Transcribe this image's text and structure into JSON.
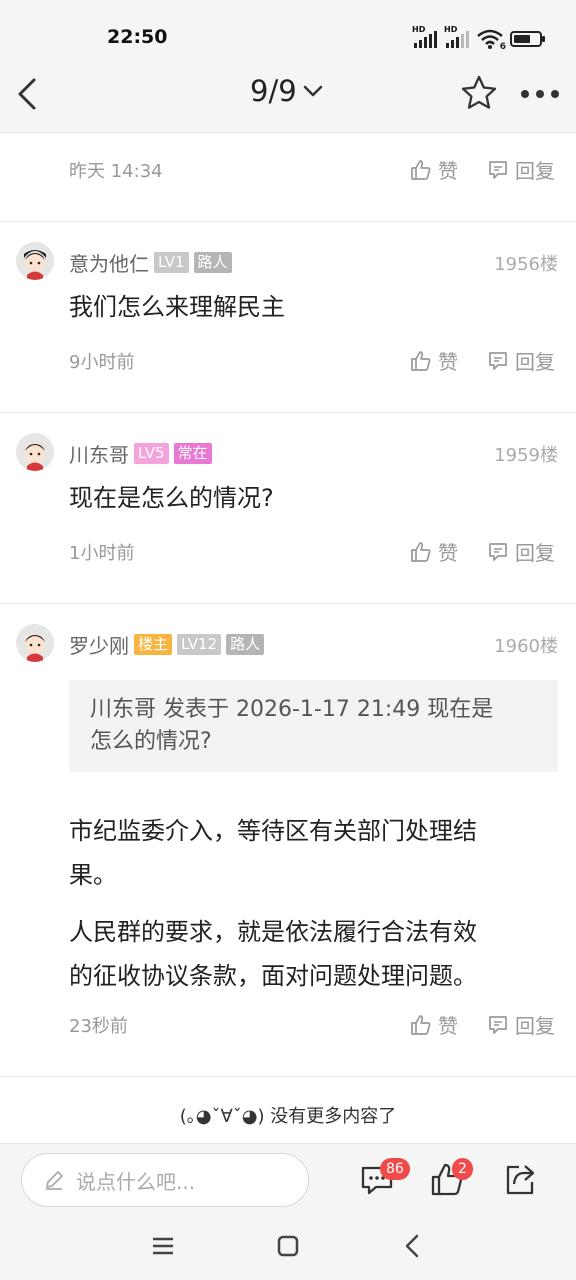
{
  "status": {
    "time": "22:50",
    "network_labels": [
      "HD",
      "HD"
    ],
    "wifi_badge": "6"
  },
  "topbar": {
    "page_indicator": "9/9"
  },
  "first_post": {
    "time": "昨天 14:34",
    "like_label": "赞",
    "reply_label": "回复"
  },
  "posts": [
    {
      "username": "意为他仁",
      "badges": [
        "LV1",
        "路人"
      ],
      "floor": "1956楼",
      "text": "我们怎么来理解民主",
      "time": "9小时前",
      "like_label": "赞",
      "reply_label": "回复"
    },
    {
      "username": "川东哥",
      "badges": [
        "LV5",
        "常在"
      ],
      "floor": "1959楼",
      "text": "现在是怎么的情况?",
      "time": "1小时前",
      "like_label": "赞",
      "reply_label": "回复"
    },
    {
      "username": "罗少刚",
      "badges": [
        "楼主",
        "LV12",
        "路人"
      ],
      "floor": "1960楼",
      "quote_line1": "川东哥 发表于 2026-1-17 21:49 现在是",
      "quote_line2": "怎么的情况?",
      "text_line1": "市纪监委介入，等待区有关部门处理结",
      "text_line2": "果。",
      "text2_line1": "人民群的要求，就是依法履行合法有效",
      "text2_line2": "的征收协议条款，面对问题处理问题。",
      "time": "23秒前",
      "like_label": "赞",
      "reply_label": "回复"
    }
  ],
  "end_text": "(｡◕ˇ∀ˇ◕) 没有更多内容了",
  "bottombar": {
    "input_placeholder": "说点什么吧...",
    "comments_count": "86",
    "likes_count": "2"
  },
  "colors": {
    "badge_lv_low": "#c8c8c8",
    "badge_lv5": "#f5a3dd",
    "badge_changzai": "#e977d4",
    "badge_louzhu": "#f7b43f",
    "badge_luren": "#b5b5b5",
    "count_badge": "#f04a4a"
  }
}
